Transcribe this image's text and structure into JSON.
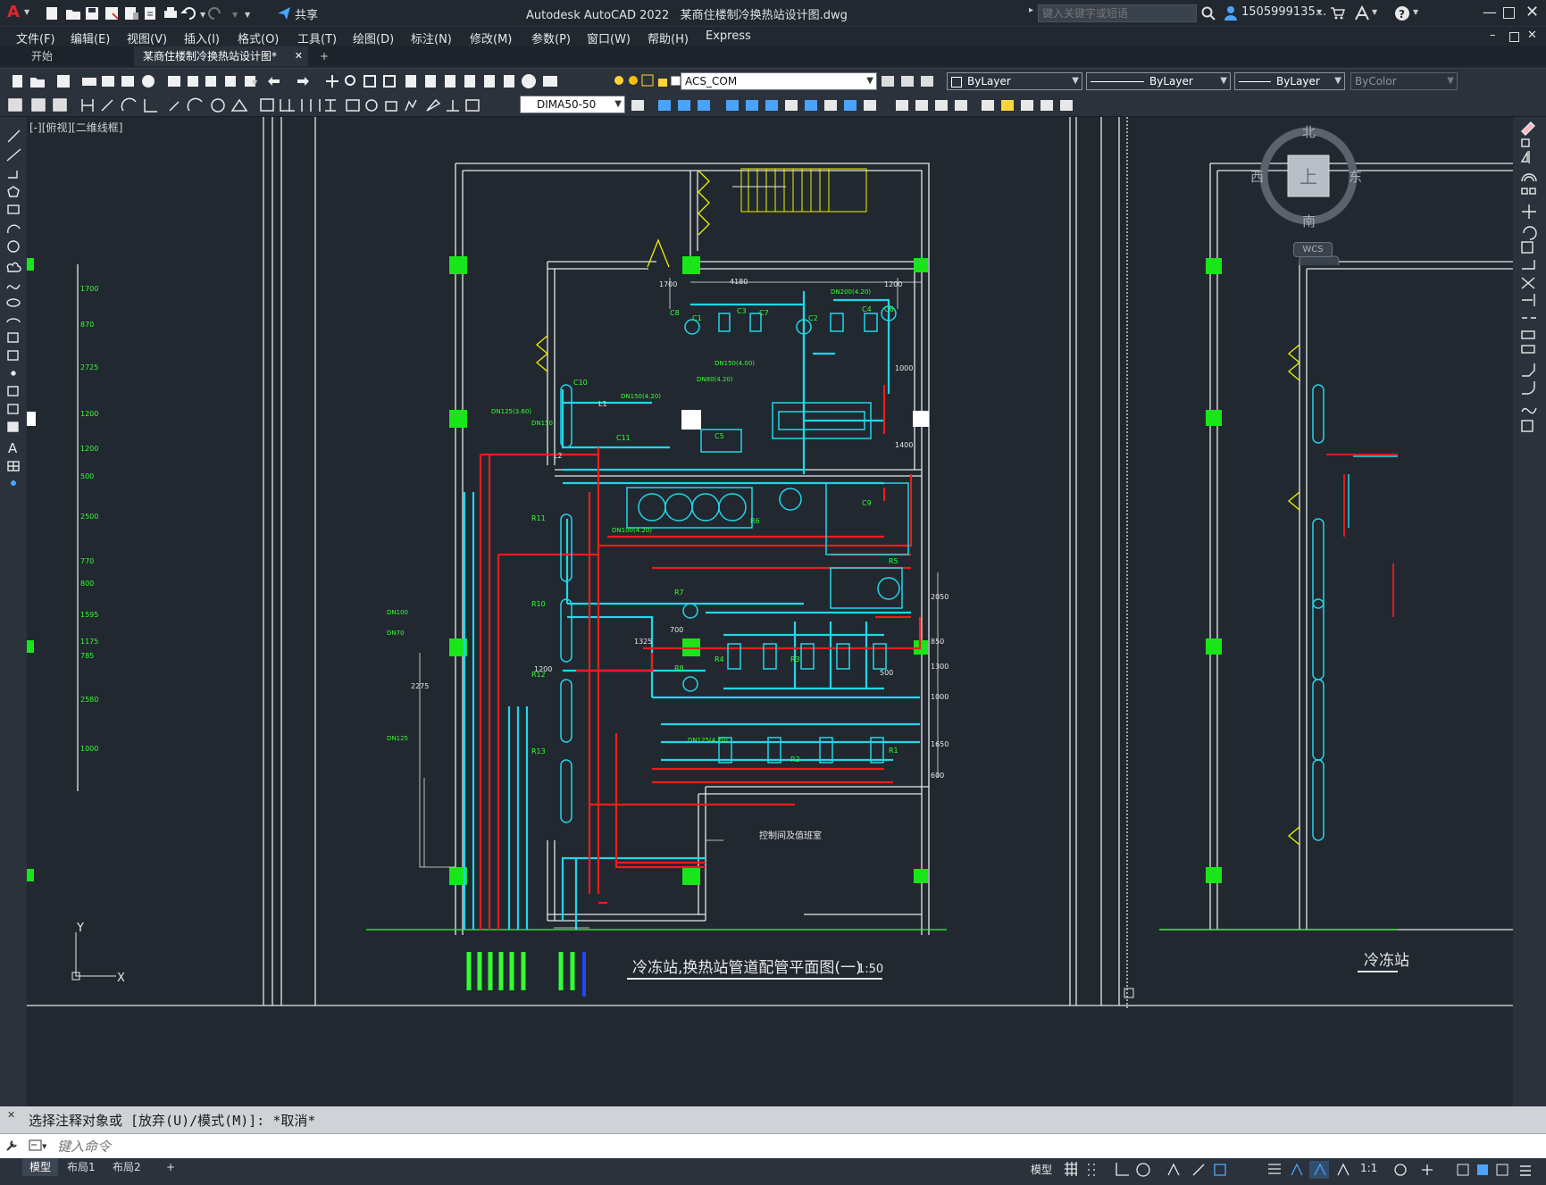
{
  "app": {
    "product": "Autodesk AutoCAD 2022",
    "document": "某商住楼制冷换热站设计图.dwg",
    "share_label": "共享",
    "search_placeholder": "键入关键字或短语",
    "user": "1505999135...",
    "brand_color": "#e0262e"
  },
  "menu": [
    "文件(F)",
    "编辑(E)",
    "视图(V)",
    "插入(I)",
    "格式(O)",
    "工具(T)",
    "绘图(D)",
    "标注(N)",
    "修改(M)",
    "参数(P)",
    "窗口(W)",
    "帮助(H)",
    "Express"
  ],
  "tabs": {
    "start": "开始",
    "active": "某商住楼制冷换热站设计图*",
    "add": "+"
  },
  "toolbar": {
    "layer": "ACS_COM",
    "color": "ByLayer",
    "linetype": "ByLayer",
    "lineweight": "ByLayer",
    "plotstyle": "ByColor",
    "dimstyle": "DIMA50-50"
  },
  "viewport": {
    "label": "[-][俯视][二维线框]",
    "compass": {
      "north": "北",
      "south": "南",
      "east": "东",
      "west": "西",
      "top": "上"
    },
    "wcs": "WCS",
    "ucs_x": "X",
    "ucs_y": "Y"
  },
  "drawing": {
    "title": "冷冻站,换热站管道配管平面图(一)",
    "scale": "1:50",
    "room_label": "控制间及值班室",
    "right_title": "冷冻站",
    "dims": [
      "4180",
      "1700",
      "1200",
      "1000",
      "1400",
      "2050",
      "850",
      "1300",
      "1000",
      "1650",
      "600",
      "500",
      "700",
      "1200",
      "2275",
      "1325"
    ],
    "left_dims": [
      "1700",
      "870",
      "2725",
      "1200",
      "1200",
      "500",
      "2500",
      "770",
      "800",
      "1595",
      "1175",
      "785",
      "2580",
      "1000"
    ],
    "pipe_labels": [
      "DN150(4.20)",
      "DN200(4.20)",
      "DN125(3.60)",
      "DN150(4.00)",
      "DN100(4.20)",
      "DN125(4.20)",
      "DN80(4.20)",
      "DN150",
      "DN125",
      "DN100",
      "DN70"
    ],
    "equipment": [
      "C1",
      "C2",
      "C3",
      "C4",
      "C5",
      "C6",
      "C7",
      "C8",
      "C9",
      "C10",
      "C11",
      "R1",
      "R2",
      "R3",
      "R4",
      "R5",
      "R6",
      "R7",
      "R8",
      "R10",
      "R11",
      "R12",
      "R13",
      "L1",
      "L2"
    ]
  },
  "command": {
    "history": "选择注释对象或 [放弃(U)/模式(M)]: *取消*",
    "placeholder": "键入命令"
  },
  "status": {
    "layouts": [
      "模型",
      "布局1",
      "布局2"
    ],
    "model_label": "模型",
    "scale": "1:1"
  },
  "colors": {
    "cyan": "#22d6e8",
    "red": "#ee1c1c",
    "green": "#33ff33",
    "white": "#e8e8e8",
    "yellow": "#f0f000",
    "blue": "#1e46ff"
  }
}
